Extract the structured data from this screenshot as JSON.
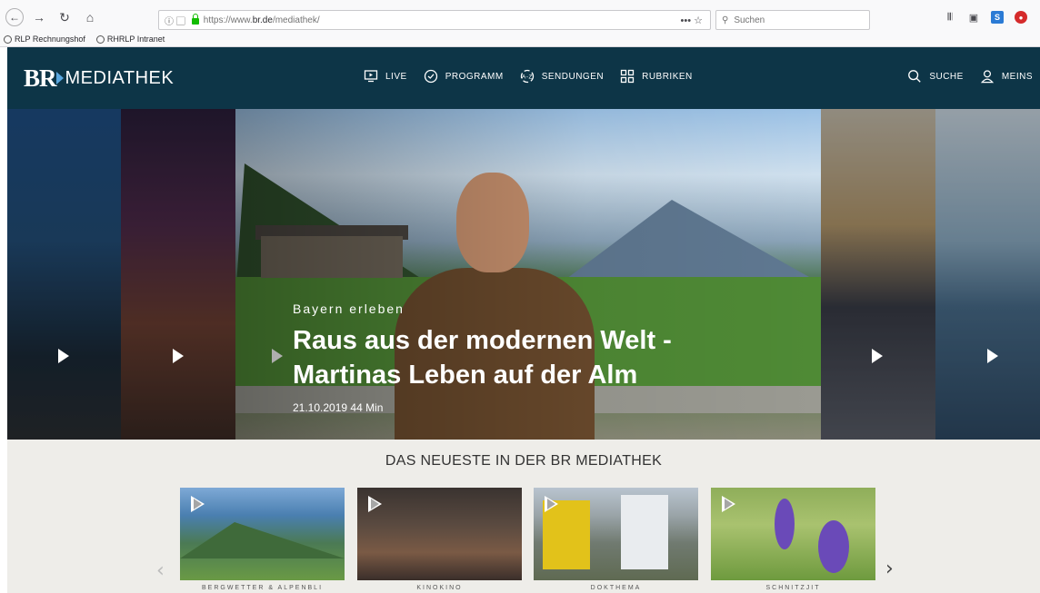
{
  "browser": {
    "url_info": "ⓘ ▢",
    "url_prefix": "https://www.",
    "url_host": "br.de",
    "url_path": "/mediathek/",
    "url_actions": "•••  ☆",
    "search_placeholder": "Suchen",
    "bookmarks": [
      "RLP Rechnungshof",
      "RHRLP Intranet"
    ]
  },
  "header": {
    "logo_br": "BR",
    "logo_text": "MEDIATHEK",
    "nav": [
      {
        "label": "LIVE",
        "icon": "tv-play-icon"
      },
      {
        "label": "PROGRAMM",
        "icon": "clock-icon"
      },
      {
        "label": "SENDUNGEN",
        "icon": "a-z-icon"
      },
      {
        "label": "RUBRIKEN",
        "icon": "grid-icon"
      }
    ],
    "search_label": "SUCHE",
    "account_label": "MEINS"
  },
  "hero": {
    "kicker": "Bayern erleben",
    "title_line1": "Raus aus der modernen Welt -",
    "title_line2": "Martinas Leben auf der Alm",
    "meta": "21.10.2019  44 Min"
  },
  "newest": {
    "title": "DAS NEUESTE IN DER BR MEDIATHEK",
    "cards": [
      {
        "label": "BERGWETTER & ALPENBLI"
      },
      {
        "label": "KINOKINO"
      },
      {
        "label": "DOKTHEMA"
      },
      {
        "label": "SCHNITZJIT"
      }
    ]
  },
  "colors": {
    "header_bg": "#0d3547",
    "section_bg": "#eeede9",
    "logo_accent": "#5aa7df"
  }
}
